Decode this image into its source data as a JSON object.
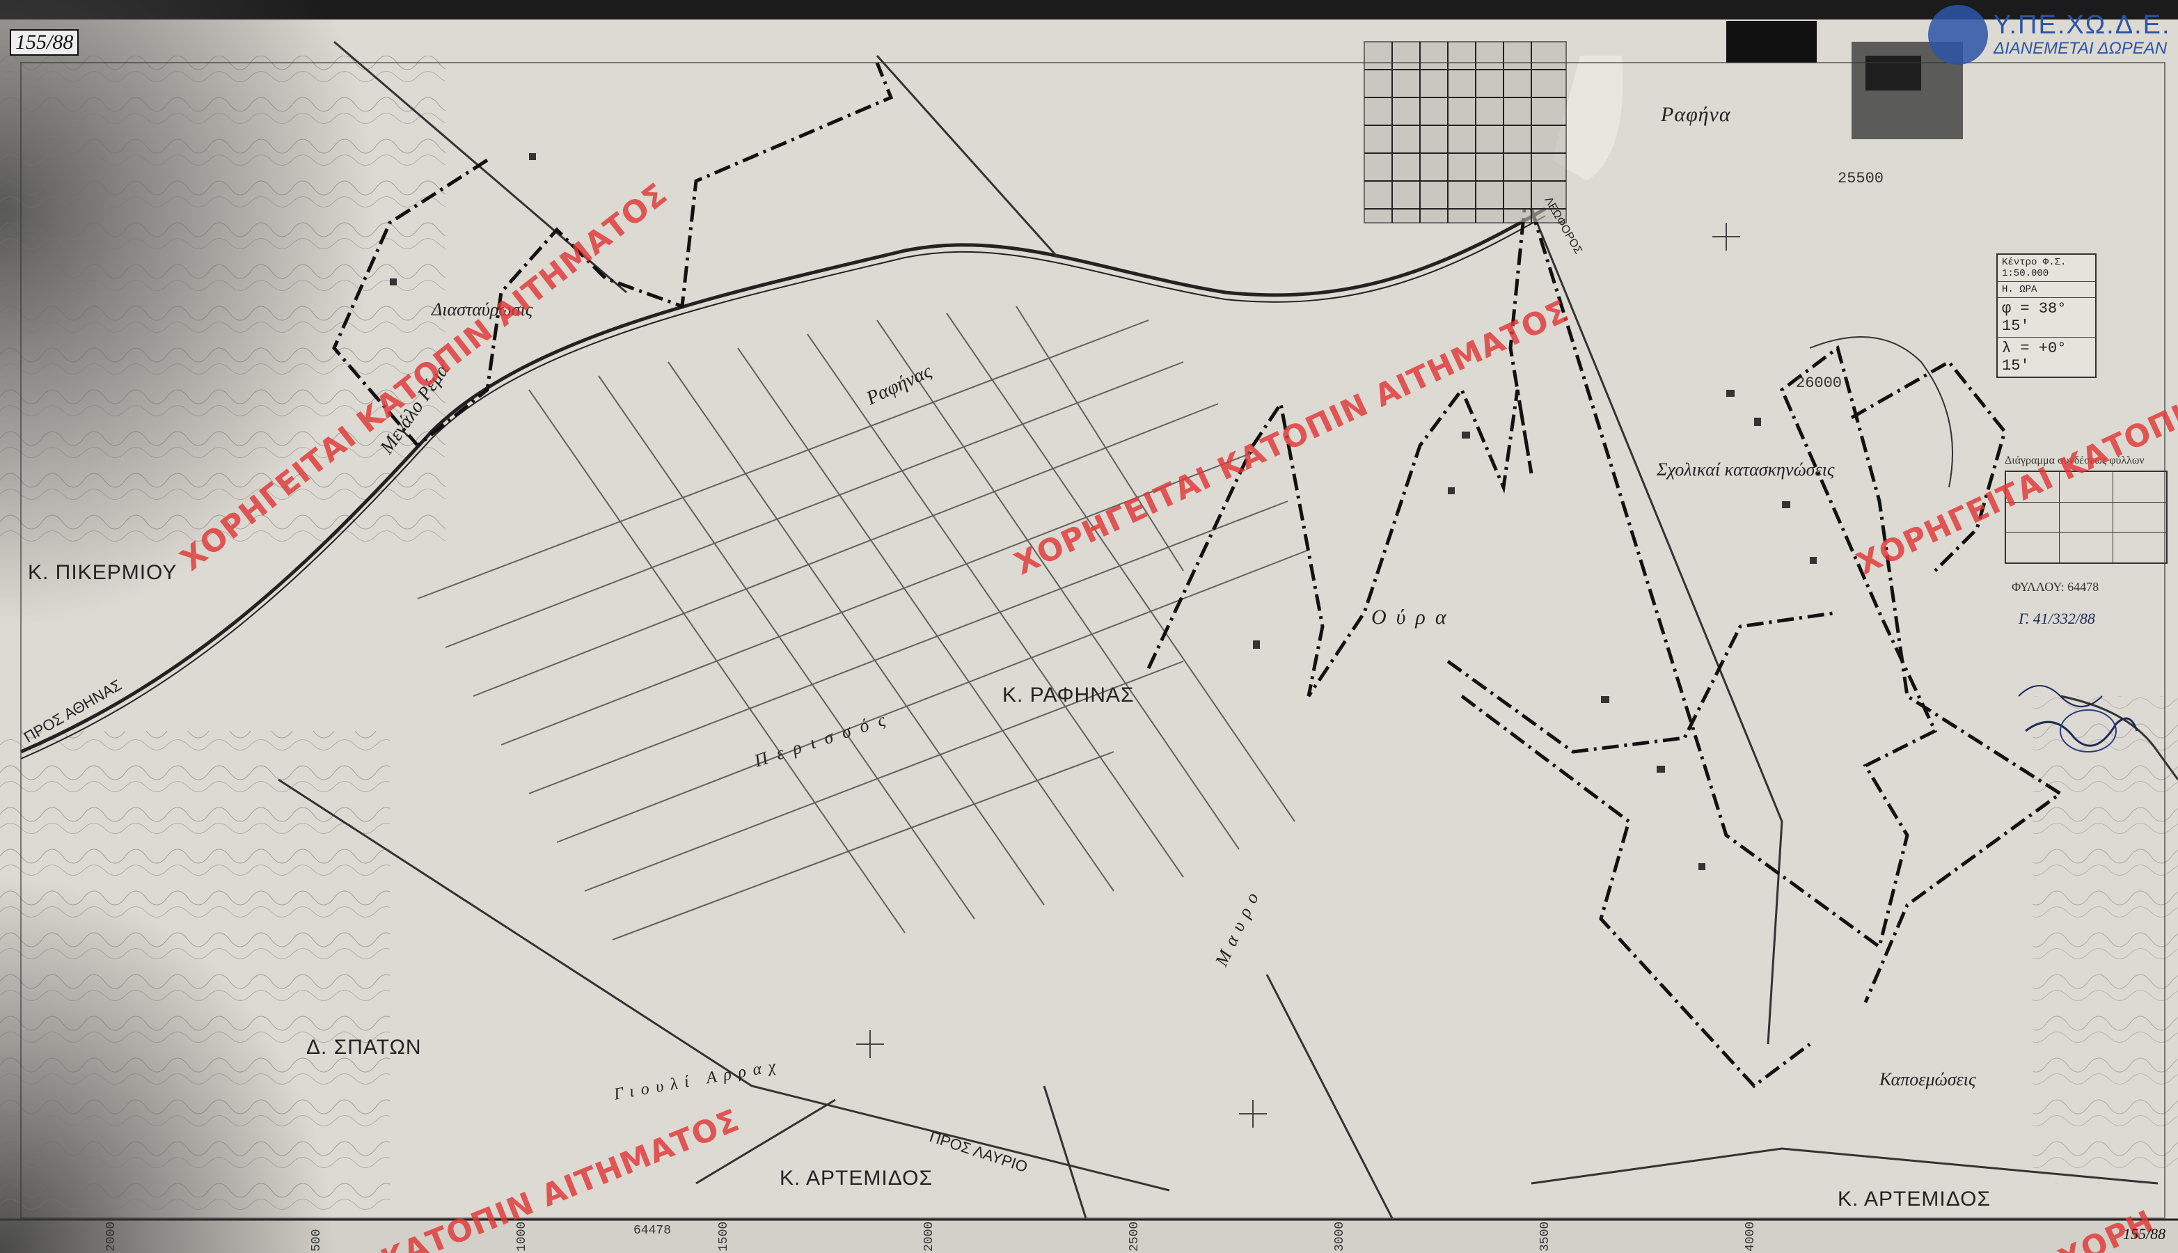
{
  "sheet_number_tl": "155/88",
  "sheet_number_br": "155/88",
  "seal": {
    "title": "Υ.ΠΕ.ΧΩ.Δ.Ε.",
    "subtitle": "ΔΙΑΝΕΜΕΤΑΙ ΔΩΡΕΑΝ",
    "color": "#2c55a8"
  },
  "watermark": {
    "text": "ΧΟΡΗΓΕΙΤΑΙ ΚΑΤΟΠΙΝ ΑΙΤΗΜΑΤΟΣ",
    "partial_bottom": "ΚΑΤΟΠΙΝ ΑΙΤΗΜΑΤΟΣ",
    "partial_corner": "ΧΟΡΗ",
    "color": "#e13737"
  },
  "places": {
    "rafina_town": "Ραφήνα",
    "rafina_k": "Κ. ΡΑΦΗΝΑΣ",
    "pikermi": "Κ. ΠΙΚΕΡΜΙΟΥ",
    "spata": "Δ. ΣΠΑΤΩΝ",
    "artemida_1": "Κ. ΑΡΤΕΜΙΔΟΣ",
    "artemida_2": "Κ. ΑΡΤΕΜΙΔΟΣ",
    "diastavrosi": "Διασταύρωσις",
    "scholikai": "Σχολικαί κατασκηνώσεις",
    "kapsalades": "Καποεμώσεις",
    "megalo": "Μεγάλο Ρέμα",
    "ragnou": "Ραφήνας",
    "oura": "Ούρα",
    "peri_sy": "Περισσός",
    "mavro": "Μαυρο",
    "giouli": "Γιουλί Αρραχ",
    "pros_laur": "ΠΡΟΣ ΛΑΥΡΙΟ",
    "pros_ath": "ΠΡΟΣ ΑΘΗΝΑΣ",
    "leoforos": "ΛΕΩΦΟΡΟΣ"
  },
  "info_box": {
    "row1": "Κέντρο Φ.Σ. 1:50.000",
    "row2": "Η. ΩΡΑ",
    "phi": "φ = 38° 15'",
    "lambda": "λ = +0° 15'"
  },
  "grid_labels": {
    "easting_top": "25500",
    "easting_mid": "26000",
    "legend_caption": "Διάγραμμα συνδέσεως φύλλων",
    "sheet_no": "ΦΥΛΛΟΥ: 64478",
    "ref_no": "Γ. 41/332/88"
  },
  "bottom_ticks": [
    "2000",
    "500",
    "1000",
    "1500",
    "2000",
    "2500",
    "3000",
    "3500",
    "4000"
  ],
  "bottom_codes": [
    "64478",
    "64478"
  ]
}
